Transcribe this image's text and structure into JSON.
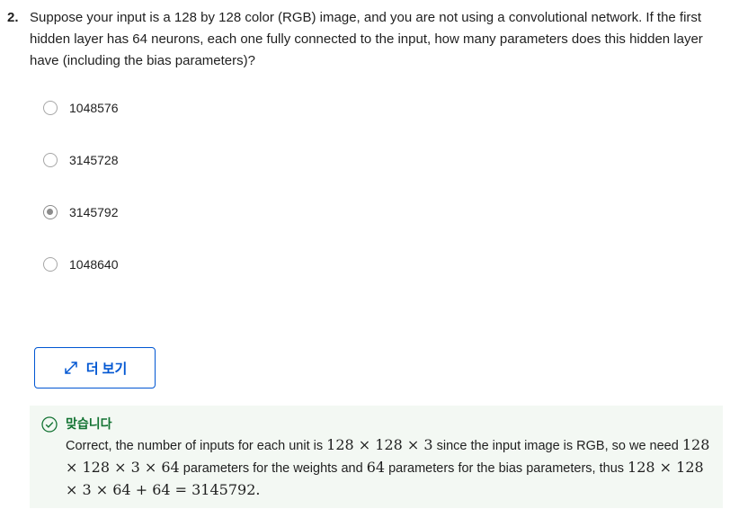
{
  "question": {
    "number": "2.",
    "text": "Suppose your input is a 128 by 128 color (RGB) image, and you are not using a convolutional network. If the first hidden layer has 64 neurons, each one fully connected to the input, how many parameters does this hidden layer have (including the bias parameters)?"
  },
  "options": [
    {
      "label": "1048576",
      "selected": false
    },
    {
      "label": "3145728",
      "selected": false
    },
    {
      "label": "3145792",
      "selected": true
    },
    {
      "label": "1048640",
      "selected": false
    }
  ],
  "more_button": {
    "label": "더 보기",
    "icon": "expand-arrows-icon"
  },
  "feedback": {
    "icon": "check-circle-icon",
    "title": "맞습니다",
    "t1": "Correct, the number of inputs for each unit is ",
    "m1": "128 × 128 × 3",
    "t2": " since the input image is RGB, so we need ",
    "m2": "128 × 128 × 3 × 64",
    "t3": " parameters for the weights and ",
    "m3": "64",
    "t4": " parameters for the bias parameters, thus ",
    "m4": "128 × 128 × 3 × 64 + 64 = 3145792."
  },
  "colors": {
    "accent": "#0056d2",
    "success": "#137333",
    "feedback_bg": "#f3f8f3"
  }
}
